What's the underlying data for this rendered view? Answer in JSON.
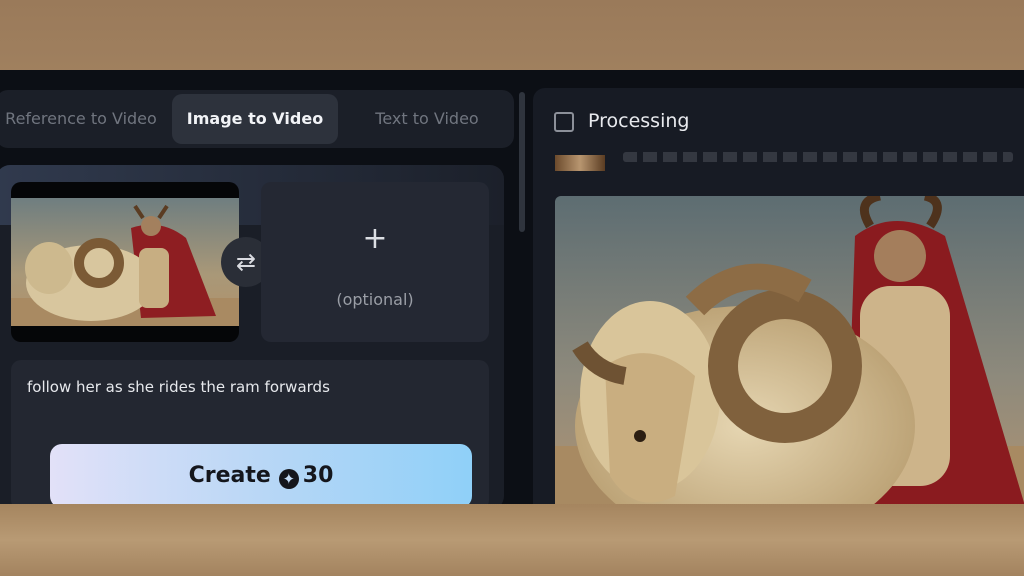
{
  "tabs": [
    {
      "label": "Reference to Video",
      "active": false
    },
    {
      "label": "Image to Video",
      "active": true
    },
    {
      "label": "Text to Video",
      "active": false
    }
  ],
  "upload": {
    "plus": "+",
    "optional_label": "(optional)"
  },
  "swap_icon": "swap-arrows-icon",
  "prompt": {
    "value": "follow her as she rides the ram forwards"
  },
  "create": {
    "label": "Create",
    "cost": "30",
    "coin_icon": "credit-coin-icon"
  },
  "status": {
    "label": "Processing"
  },
  "colors": {
    "background": "#0c0f15",
    "panel": "#1a1e27",
    "active_tab": "#2d323c",
    "create_gradient_start": "#e2e1f8",
    "create_gradient_end": "#8fd0f8"
  }
}
